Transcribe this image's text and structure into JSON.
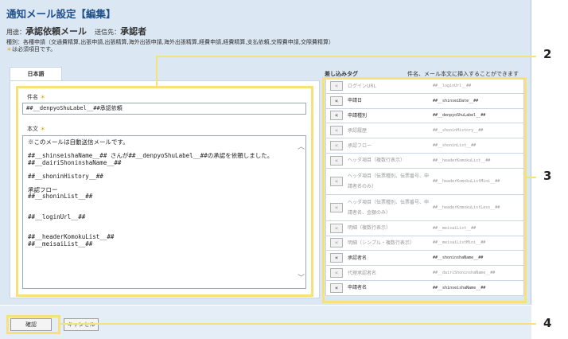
{
  "title": "通知メール設定【編集】",
  "usage": {
    "prefix": "用途：",
    "value": "承認依頼メール",
    "sender_prefix": "送信先：",
    "sender": "承認者"
  },
  "kind_text": "種別：各種申請（交通費精算,出張申請,出張精算,海外出張申請,海外出張精算,経費申請,経費精算,支払依頼,交際費申請,交際費精算）",
  "required_note_mark": "＊",
  "required_note": "は必須項目です。",
  "tab": "日本語",
  "subject": {
    "label": "件名",
    "mark": "＊",
    "value": "##__denpyoShuLabel__##承認依頼"
  },
  "body": {
    "label": "本文",
    "mark": "＊",
    "lines": [
      "※このメールは自動送信メールです。",
      "",
      "##__shinseishaName__## さんが##__denpyoShuLabel__##の承認を依頼しました。",
      "##__dairiShoninshaName__##",
      "",
      "##__shoninHistory__##",
      "",
      "承認フロー",
      "##__shoninList__##",
      "",
      "",
      "##__loginUrl__##",
      "",
      "",
      "##__headerKomokuList__##",
      "##__meisaiList__##"
    ]
  },
  "tags_header": "差し込みタグ",
  "tags_desc": "件名、メール本文に挿入することができます",
  "tags": [
    {
      "name": "ログインURL",
      "code": "##__loginUrl__##",
      "enabled": false,
      "tall": false
    },
    {
      "name": "申請日",
      "code": "##__shinseiDate__##",
      "enabled": true,
      "tall": false
    },
    {
      "name": "申請種別",
      "code": "##__denpyoShuLabel__##",
      "enabled": true,
      "tall": false
    },
    {
      "name": "承認履歴",
      "code": "##__shoninHistory__##",
      "enabled": false,
      "tall": false
    },
    {
      "name": "承認フロー",
      "code": "##__shoninList__##",
      "enabled": false,
      "tall": false
    },
    {
      "name": "ヘッダ項目（複数行表示）",
      "code": "##__headerKomokuList__##",
      "enabled": false,
      "tall": false
    },
    {
      "name": "ヘッダ項目（伝票種別、伝票番号、申請者名のみ）",
      "code": "##__headerKomokuListMini__##",
      "enabled": false,
      "tall": true
    },
    {
      "name": "ヘッダ項目（伝票種別、伝票番号、申請者名、金額のみ）",
      "code": "##__headerKomokuListLess__##",
      "enabled": false,
      "tall": true
    },
    {
      "name": "明細（複数行表示）",
      "code": "##__meisaiList__##",
      "enabled": false,
      "tall": false
    },
    {
      "name": "明細（シンプル・複数行表示）",
      "code": "##__meisaiListMini__##",
      "enabled": false,
      "tall": false
    },
    {
      "name": "承認者名",
      "code": "##__shoninshaName__##",
      "enabled": true,
      "tall": false
    },
    {
      "name": "代理承認者名",
      "code": "##__dairiShoninshaName__##",
      "enabled": false,
      "tall": false
    },
    {
      "name": "申請者名",
      "code": "##__shinseishaName__##",
      "enabled": true,
      "tall": false
    }
  ],
  "insert_icon": "«",
  "buttons": {
    "confirm": "確認",
    "cancel": "キャンセル"
  },
  "callouts": {
    "c2": "2",
    "c3": "3",
    "c4": "4"
  },
  "colors": {
    "title": "#1f4f8a",
    "highlight": "#f7e27a",
    "required": "#e8a000",
    "background": "#dbe7f3"
  }
}
